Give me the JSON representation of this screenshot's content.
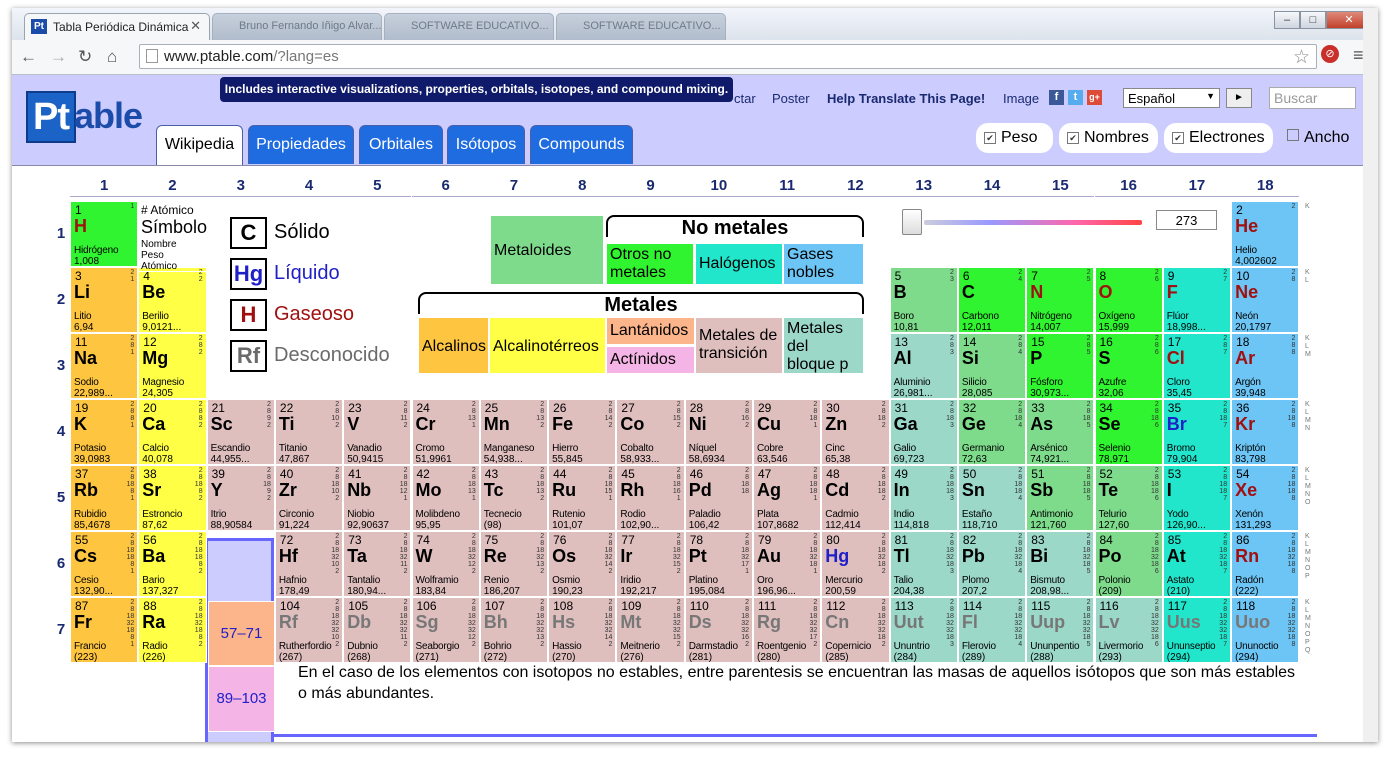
{
  "browser": {
    "tab_title": "Tabla Periódica Dinámica",
    "tab_favicon": "Pt",
    "ghost_tabs": [
      "Bruno Fernando Iñigo Alvar...",
      "SOFTWARE EDUCATIVO...",
      "SOFTWARE EDUCATIVO..."
    ],
    "url_host": "www.ptable.com",
    "url_path": "/?lang=es",
    "window_controls": [
      "–",
      "□",
      "✕"
    ]
  },
  "header": {
    "logo_pt": "Pt",
    "logo_rest": "able",
    "tooltip": "Includes interactive visualizations, properties, orbitals, isotopes, and compound mixing.",
    "links": {
      "contact": "ctar",
      "poster": "Poster",
      "translate": "Help Translate This Page!",
      "image": "Image"
    },
    "social": [
      "f",
      "t",
      "g+"
    ],
    "language": "Español",
    "go_button": "►",
    "search_placeholder": "Buscar",
    "tabs": [
      "Wikipedia",
      "Propiedades",
      "Orbitales",
      "Isótopos",
      "Compounds"
    ],
    "checkboxes": [
      {
        "label": "Peso",
        "checked": true
      },
      {
        "label": "Nombres",
        "checked": true
      },
      {
        "label": "Electrones",
        "checked": true
      },
      {
        "label": "Ancho",
        "checked": false
      }
    ]
  },
  "groups": [
    "1",
    "2",
    "3",
    "4",
    "5",
    "6",
    "7",
    "8",
    "9",
    "10",
    "11",
    "12",
    "13",
    "14",
    "15",
    "16",
    "17",
    "18"
  ],
  "periods": [
    "1",
    "2",
    "3",
    "4",
    "5",
    "6",
    "7"
  ],
  "key_cell": {
    "line1": "# Atómico",
    "line2": "Símbolo",
    "line3": "Nombre",
    "line4": "Peso",
    "line5": "Atómico"
  },
  "legend_states": [
    {
      "symbol": "C",
      "label": "Sólido",
      "color": "#000000"
    },
    {
      "symbol": "Hg",
      "label": "Líquido",
      "color": "#2020c8"
    },
    {
      "symbol": "H",
      "label": "Gaseoso",
      "color": "#a01010"
    },
    {
      "symbol": "Rf",
      "label": "Desconocido",
      "color": "#6a6a6a"
    }
  ],
  "legend_categories": {
    "nonmetals_title": "No metales",
    "metals_title": "Metales",
    "metaloides": "Metaloides",
    "otros": "Otros no metales",
    "halogenos": "Halógenos",
    "gases": "Gases nobles",
    "alcalinos": "Alcalinos",
    "alcalinoterreos": "Alcalinotérreos",
    "lantanidos": "Lantánidos",
    "actinidos": "Actínidos",
    "transicion": "Metales de transición",
    "bloquep": "Metales del bloque p"
  },
  "temperature": "273",
  "series_placeholders": [
    "57–71",
    "89–103"
  ],
  "footnote": "En el caso de los elementos con isotopos no estables, entre parentesis se encuentran las masas de aquellos isótopos que son más estables o más abundantes.",
  "shell_labels": [
    "K",
    "K L",
    "K L M",
    "K L M N",
    "K L M N O",
    "K L M N O P",
    "K L M N O P Q"
  ],
  "colors": {
    "alkali": "#fec640",
    "alkaline": "#ffff45",
    "transition": "#dfbebe",
    "ptrans": "#9cd8c8",
    "metalloid": "#7edb8c",
    "nonmetal": "#2ff42f",
    "halogen": "#22e6cc",
    "noble": "#6dc5f5",
    "lanth": "#fcb58a",
    "actin": "#f4b4e6",
    "accent": "#1f6ce0",
    "header_bg": "#ccccff"
  },
  "elements": [
    {
      "z": "1",
      "s": "H",
      "n": "Hidrógeno",
      "w": "1,008",
      "g": 1,
      "p": 1,
      "c": "nonmetal",
      "st": "gas",
      "e": "1"
    },
    {
      "z": "2",
      "s": "He",
      "n": "Helio",
      "w": "4,002602",
      "g": 18,
      "p": 1,
      "c": "noble",
      "st": "gas",
      "e": "2"
    },
    {
      "z": "3",
      "s": "Li",
      "n": "Litio",
      "w": "6,94",
      "g": 1,
      "p": 2,
      "c": "alkali",
      "st": "solid",
      "e": "2 1"
    },
    {
      "z": "4",
      "s": "Be",
      "n": "Berilio",
      "w": "9,0121...",
      "g": 2,
      "p": 2,
      "c": "alkaline",
      "st": "solid",
      "e": "2 2"
    },
    {
      "z": "5",
      "s": "B",
      "n": "Boro",
      "w": "10,81",
      "g": 13,
      "p": 2,
      "c": "metalloid",
      "st": "solid",
      "e": "2 3"
    },
    {
      "z": "6",
      "s": "C",
      "n": "Carbono",
      "w": "12,011",
      "g": 14,
      "p": 2,
      "c": "nonmetal",
      "st": "solid",
      "e": "2 4"
    },
    {
      "z": "7",
      "s": "N",
      "n": "Nitrógeno",
      "w": "14,007",
      "g": 15,
      "p": 2,
      "c": "nonmetal",
      "st": "gas",
      "e": "2 5"
    },
    {
      "z": "8",
      "s": "O",
      "n": "Oxígeno",
      "w": "15,999",
      "g": 16,
      "p": 2,
      "c": "nonmetal",
      "st": "gas",
      "e": "2 6"
    },
    {
      "z": "9",
      "s": "F",
      "n": "Flúor",
      "w": "18,998...",
      "g": 17,
      "p": 2,
      "c": "halogen",
      "st": "gas",
      "e": "2 7"
    },
    {
      "z": "10",
      "s": "Ne",
      "n": "Neón",
      "w": "20,1797",
      "g": 18,
      "p": 2,
      "c": "noble",
      "st": "gas",
      "e": "2 8"
    },
    {
      "z": "11",
      "s": "Na",
      "n": "Sodio",
      "w": "22,989...",
      "g": 1,
      "p": 3,
      "c": "alkali",
      "st": "solid",
      "e": "2 8 1"
    },
    {
      "z": "12",
      "s": "Mg",
      "n": "Magnesio",
      "w": "24,305",
      "g": 2,
      "p": 3,
      "c": "alkaline",
      "st": "solid",
      "e": "2 8 2"
    },
    {
      "z": "13",
      "s": "Al",
      "n": "Aluminio",
      "w": "26,981...",
      "g": 13,
      "p": 3,
      "c": "ptrans",
      "st": "solid",
      "e": "2 8 3"
    },
    {
      "z": "14",
      "s": "Si",
      "n": "Silicio",
      "w": "28,085",
      "g": 14,
      "p": 3,
      "c": "metalloid",
      "st": "solid",
      "e": "2 8 4"
    },
    {
      "z": "15",
      "s": "P",
      "n": "Fósforo",
      "w": "30,973...",
      "g": 15,
      "p": 3,
      "c": "nonmetal",
      "st": "solid",
      "e": "2 8 5"
    },
    {
      "z": "16",
      "s": "S",
      "n": "Azufre",
      "w": "32,06",
      "g": 16,
      "p": 3,
      "c": "nonmetal",
      "st": "solid",
      "e": "2 8 6"
    },
    {
      "z": "17",
      "s": "Cl",
      "n": "Cloro",
      "w": "35,45",
      "g": 17,
      "p": 3,
      "c": "halogen",
      "st": "gas",
      "e": "2 8 7"
    },
    {
      "z": "18",
      "s": "Ar",
      "n": "Argón",
      "w": "39,948",
      "g": 18,
      "p": 3,
      "c": "noble",
      "st": "gas",
      "e": "2 8 8"
    },
    {
      "z": "19",
      "s": "K",
      "n": "Potasio",
      "w": "39,0983",
      "g": 1,
      "p": 4,
      "c": "alkali",
      "st": "solid",
      "e": "2 8 8 1"
    },
    {
      "z": "20",
      "s": "Ca",
      "n": "Calcio",
      "w": "40,078",
      "g": 2,
      "p": 4,
      "c": "alkaline",
      "st": "solid",
      "e": "2 8 8 2"
    },
    {
      "z": "21",
      "s": "Sc",
      "n": "Escandio",
      "w": "44,955...",
      "g": 3,
      "p": 4,
      "c": "transition",
      "st": "solid",
      "e": "2 8 9 2"
    },
    {
      "z": "22",
      "s": "Ti",
      "n": "Titanio",
      "w": "47,867",
      "g": 4,
      "p": 4,
      "c": "transition",
      "st": "solid",
      "e": "2 8 10 2"
    },
    {
      "z": "23",
      "s": "V",
      "n": "Vanadio",
      "w": "50,9415",
      "g": 5,
      "p": 4,
      "c": "transition",
      "st": "solid",
      "e": "2 8 11 2"
    },
    {
      "z": "24",
      "s": "Cr",
      "n": "Cromo",
      "w": "51,9961",
      "g": 6,
      "p": 4,
      "c": "transition",
      "st": "solid",
      "e": "2 8 13 1"
    },
    {
      "z": "25",
      "s": "Mn",
      "n": "Manganeso",
      "w": "54,938...",
      "g": 7,
      "p": 4,
      "c": "transition",
      "st": "solid",
      "e": "2 8 13 2"
    },
    {
      "z": "26",
      "s": "Fe",
      "n": "Hierro",
      "w": "55,845",
      "g": 8,
      "p": 4,
      "c": "transition",
      "st": "solid",
      "e": "2 8 14 2"
    },
    {
      "z": "27",
      "s": "Co",
      "n": "Cobalto",
      "w": "58,933...",
      "g": 9,
      "p": 4,
      "c": "transition",
      "st": "solid",
      "e": "2 8 15 2"
    },
    {
      "z": "28",
      "s": "Ni",
      "n": "Níquel",
      "w": "58,6934",
      "g": 10,
      "p": 4,
      "c": "transition",
      "st": "solid",
      "e": "2 8 16 2"
    },
    {
      "z": "29",
      "s": "Cu",
      "n": "Cobre",
      "w": "63,546",
      "g": 11,
      "p": 4,
      "c": "transition",
      "st": "solid",
      "e": "2 8 18 1"
    },
    {
      "z": "30",
      "s": "Zn",
      "n": "Cinc",
      "w": "65,38",
      "g": 12,
      "p": 4,
      "c": "transition",
      "st": "solid",
      "e": "2 8 18 2"
    },
    {
      "z": "31",
      "s": "Ga",
      "n": "Galio",
      "w": "69,723",
      "g": 13,
      "p": 4,
      "c": "ptrans",
      "st": "solid",
      "e": "2 8 18 3"
    },
    {
      "z": "32",
      "s": "Ge",
      "n": "Germanio",
      "w": "72,63",
      "g": 14,
      "p": 4,
      "c": "metalloid",
      "st": "solid",
      "e": "2 8 18 4"
    },
    {
      "z": "33",
      "s": "As",
      "n": "Arsénico",
      "w": "74,921...",
      "g": 15,
      "p": 4,
      "c": "metalloid",
      "st": "solid",
      "e": "2 8 18 5"
    },
    {
      "z": "34",
      "s": "Se",
      "n": "Selenio",
      "w": "78,971",
      "g": 16,
      "p": 4,
      "c": "nonmetal",
      "st": "solid",
      "e": "2 8 18 6"
    },
    {
      "z": "35",
      "s": "Br",
      "n": "Bromo",
      "w": "79,904",
      "g": 17,
      "p": 4,
      "c": "halogen",
      "st": "liquid",
      "e": "2 8 18 7"
    },
    {
      "z": "36",
      "s": "Kr",
      "n": "Kriptón",
      "w": "83,798",
      "g": 18,
      "p": 4,
      "c": "noble",
      "st": "gas",
      "e": "2 8 18 8"
    },
    {
      "z": "37",
      "s": "Rb",
      "n": "Rubidio",
      "w": "85,4678",
      "g": 1,
      "p": 5,
      "c": "alkali",
      "st": "solid",
      "e": "2 8 18 8 1"
    },
    {
      "z": "38",
      "s": "Sr",
      "n": "Estroncio",
      "w": "87,62",
      "g": 2,
      "p": 5,
      "c": "alkaline",
      "st": "solid",
      "e": "2 8 18 8 2"
    },
    {
      "z": "39",
      "s": "Y",
      "n": "Itrio",
      "w": "88,90584",
      "g": 3,
      "p": 5,
      "c": "transition",
      "st": "solid",
      "e": "2 8 18 9 2"
    },
    {
      "z": "40",
      "s": "Zr",
      "n": "Circonio",
      "w": "91,224",
      "g": 4,
      "p": 5,
      "c": "transition",
      "st": "solid",
      "e": "2 8 18 10 2"
    },
    {
      "z": "41",
      "s": "Nb",
      "n": "Niobio",
      "w": "92,90637",
      "g": 5,
      "p": 5,
      "c": "transition",
      "st": "solid",
      "e": "2 8 18 12 1"
    },
    {
      "z": "42",
      "s": "Mo",
      "n": "Molibdeno",
      "w": "95,95",
      "g": 6,
      "p": 5,
      "c": "transition",
      "st": "solid",
      "e": "2 8 18 13 1"
    },
    {
      "z": "43",
      "s": "Tc",
      "n": "Tecnecio",
      "w": "(98)",
      "g": 7,
      "p": 5,
      "c": "transition",
      "st": "solid",
      "e": "2 8 18 13 2"
    },
    {
      "z": "44",
      "s": "Ru",
      "n": "Rutenio",
      "w": "101,07",
      "g": 8,
      "p": 5,
      "c": "transition",
      "st": "solid",
      "e": "2 8 18 15 1"
    },
    {
      "z": "45",
      "s": "Rh",
      "n": "Rodio",
      "w": "102,90...",
      "g": 9,
      "p": 5,
      "c": "transition",
      "st": "solid",
      "e": "2 8 18 16 1"
    },
    {
      "z": "46",
      "s": "Pd",
      "n": "Paladio",
      "w": "106,42",
      "g": 10,
      "p": 5,
      "c": "transition",
      "st": "solid",
      "e": "2 8 18 18"
    },
    {
      "z": "47",
      "s": "Ag",
      "n": "Plata",
      "w": "107,8682",
      "g": 11,
      "p": 5,
      "c": "transition",
      "st": "solid",
      "e": "2 8 18 18 1"
    },
    {
      "z": "48",
      "s": "Cd",
      "n": "Cadmio",
      "w": "112,414",
      "g": 12,
      "p": 5,
      "c": "transition",
      "st": "solid",
      "e": "2 8 18 18 2"
    },
    {
      "z": "49",
      "s": "In",
      "n": "Indio",
      "w": "114,818",
      "g": 13,
      "p": 5,
      "c": "ptrans",
      "st": "solid",
      "e": "2 8 18 18 3"
    },
    {
      "z": "50",
      "s": "Sn",
      "n": "Estaño",
      "w": "118,710",
      "g": 14,
      "p": 5,
      "c": "ptrans",
      "st": "solid",
      "e": "2 8 18 18 4"
    },
    {
      "z": "51",
      "s": "Sb",
      "n": "Antimonio",
      "w": "121,760",
      "g": 15,
      "p": 5,
      "c": "metalloid",
      "st": "solid",
      "e": "2 8 18 18 5"
    },
    {
      "z": "52",
      "s": "Te",
      "n": "Telurio",
      "w": "127,60",
      "g": 16,
      "p": 5,
      "c": "metalloid",
      "st": "solid",
      "e": "2 8 18 18 6"
    },
    {
      "z": "53",
      "s": "I",
      "n": "Yodo",
      "w": "126,90...",
      "g": 17,
      "p": 5,
      "c": "halogen",
      "st": "solid",
      "e": "2 8 18 18 7"
    },
    {
      "z": "54",
      "s": "Xe",
      "n": "Xenón",
      "w": "131,293",
      "g": 18,
      "p": 5,
      "c": "noble",
      "st": "gas",
      "e": "2 8 18 18 8"
    },
    {
      "z": "55",
      "s": "Cs",
      "n": "Cesio",
      "w": "132,90...",
      "g": 1,
      "p": 6,
      "c": "alkali",
      "st": "solid",
      "e": "2 8 18 18 8 1"
    },
    {
      "z": "56",
      "s": "Ba",
      "n": "Bario",
      "w": "137,327",
      "g": 2,
      "p": 6,
      "c": "alkaline",
      "st": "solid",
      "e": "2 8 18 18 8 2"
    },
    {
      "z": "72",
      "s": "Hf",
      "n": "Hafnio",
      "w": "178,49",
      "g": 4,
      "p": 6,
      "c": "transition",
      "st": "solid",
      "e": "2 8 18 32 10 2"
    },
    {
      "z": "73",
      "s": "Ta",
      "n": "Tantalio",
      "w": "180,94...",
      "g": 5,
      "p": 6,
      "c": "transition",
      "st": "solid",
      "e": "2 8 18 32 11 2"
    },
    {
      "z": "74",
      "s": "W",
      "n": "Wolframio",
      "w": "183,84",
      "g": 6,
      "p": 6,
      "c": "transition",
      "st": "solid",
      "e": "2 8 18 32 12 2"
    },
    {
      "z": "75",
      "s": "Re",
      "n": "Renio",
      "w": "186,207",
      "g": 7,
      "p": 6,
      "c": "transition",
      "st": "solid",
      "e": "2 8 18 32 13 2"
    },
    {
      "z": "76",
      "s": "Os",
      "n": "Osmio",
      "w": "190,23",
      "g": 8,
      "p": 6,
      "c": "transition",
      "st": "solid",
      "e": "2 8 18 32 14 2"
    },
    {
      "z": "77",
      "s": "Ir",
      "n": "Iridio",
      "w": "192,217",
      "g": 9,
      "p": 6,
      "c": "transition",
      "st": "solid",
      "e": "2 8 18 32 15 2"
    },
    {
      "z": "78",
      "s": "Pt",
      "n": "Platino",
      "w": "195,084",
      "g": 10,
      "p": 6,
      "c": "transition",
      "st": "solid",
      "e": "2 8 18 32 17 1"
    },
    {
      "z": "79",
      "s": "Au",
      "n": "Oro",
      "w": "196,96...",
      "g": 11,
      "p": 6,
      "c": "transition",
      "st": "solid",
      "e": "2 8 18 32 18 1"
    },
    {
      "z": "80",
      "s": "Hg",
      "n": "Mercurio",
      "w": "200,59",
      "g": 12,
      "p": 6,
      "c": "transition",
      "st": "liquid",
      "e": "2 8 18 32 18 2"
    },
    {
      "z": "81",
      "s": "Tl",
      "n": "Talio",
      "w": "204,38",
      "g": 13,
      "p": 6,
      "c": "ptrans",
      "st": "solid",
      "e": "2 8 18 32 18 3"
    },
    {
      "z": "82",
      "s": "Pb",
      "n": "Plomo",
      "w": "207,2",
      "g": 14,
      "p": 6,
      "c": "ptrans",
      "st": "solid",
      "e": "2 8 18 32 18 4"
    },
    {
      "z": "83",
      "s": "Bi",
      "n": "Bismuto",
      "w": "208,98...",
      "g": 15,
      "p": 6,
      "c": "ptrans",
      "st": "solid",
      "e": "2 8 18 32 18 5"
    },
    {
      "z": "84",
      "s": "Po",
      "n": "Polonio",
      "w": "(209)",
      "g": 16,
      "p": 6,
      "c": "metalloid",
      "st": "solid",
      "e": "2 8 18 32 18 6"
    },
    {
      "z": "85",
      "s": "At",
      "n": "Astato",
      "w": "(210)",
      "g": 17,
      "p": 6,
      "c": "halogen",
      "st": "solid",
      "e": "2 8 18 32 18 7"
    },
    {
      "z": "86",
      "s": "Rn",
      "n": "Radón",
      "w": "(222)",
      "g": 18,
      "p": 6,
      "c": "noble",
      "st": "gas",
      "e": "2 8 18 32 18 8"
    },
    {
      "z": "87",
      "s": "Fr",
      "n": "Francio",
      "w": "(223)",
      "g": 1,
      "p": 7,
      "c": "alkali",
      "st": "solid",
      "e": "2 8 18 32 18 8 1"
    },
    {
      "z": "88",
      "s": "Ra",
      "n": "Radio",
      "w": "(226)",
      "g": 2,
      "p": 7,
      "c": "alkaline",
      "st": "solid",
      "e": "2 8 18 32 18 8 2"
    },
    {
      "z": "104",
      "s": "Rf",
      "n": "Rutherfordio",
      "w": "(267)",
      "g": 4,
      "p": 7,
      "c": "transition",
      "st": "unknown",
      "e": "2 8 18 32 32 10 2"
    },
    {
      "z": "105",
      "s": "Db",
      "n": "Dubnio",
      "w": "(268)",
      "g": 5,
      "p": 7,
      "c": "transition",
      "st": "unknown",
      "e": "2 8 18 32 32 11 2"
    },
    {
      "z": "106",
      "s": "Sg",
      "n": "Seaborgio",
      "w": "(271)",
      "g": 6,
      "p": 7,
      "c": "transition",
      "st": "unknown",
      "e": "2 8 18 32 32 12 2"
    },
    {
      "z": "107",
      "s": "Bh",
      "n": "Bohrio",
      "w": "(272)",
      "g": 7,
      "p": 7,
      "c": "transition",
      "st": "unknown",
      "e": "2 8 18 32 32 13 2"
    },
    {
      "z": "108",
      "s": "Hs",
      "n": "Hassio",
      "w": "(270)",
      "g": 8,
      "p": 7,
      "c": "transition",
      "st": "unknown",
      "e": "2 8 18 32 32 14 2"
    },
    {
      "z": "109",
      "s": "Mt",
      "n": "Meitnerio",
      "w": "(276)",
      "g": 9,
      "p": 7,
      "c": "transition",
      "st": "unknown",
      "e": "2 8 18 32 32 15 2"
    },
    {
      "z": "110",
      "s": "Ds",
      "n": "Darmstadio",
      "w": "(281)",
      "g": 10,
      "p": 7,
      "c": "transition",
      "st": "unknown",
      "e": "2 8 18 32 32 16 2"
    },
    {
      "z": "111",
      "s": "Rg",
      "n": "Roentgenio",
      "w": "(280)",
      "g": 11,
      "p": 7,
      "c": "transition",
      "st": "unknown",
      "e": "2 8 18 32 32 17 2"
    },
    {
      "z": "112",
      "s": "Cn",
      "n": "Copernicio",
      "w": "(285)",
      "g": 12,
      "p": 7,
      "c": "transition",
      "st": "unknown",
      "e": "2 8 18 32 32 18 2"
    },
    {
      "z": "113",
      "s": "Uut",
      "n": "Ununtrio",
      "w": "(284)",
      "g": 13,
      "p": 7,
      "c": "ptrans",
      "st": "unknown",
      "e": "2 8 18 32 32 18 3"
    },
    {
      "z": "114",
      "s": "Fl",
      "n": "Flerovio",
      "w": "(289)",
      "g": 14,
      "p": 7,
      "c": "ptrans",
      "st": "unknown",
      "e": "2 8 18 32 32 18 4"
    },
    {
      "z": "115",
      "s": "Uup",
      "n": "Ununpentio",
      "w": "(288)",
      "g": 15,
      "p": 7,
      "c": "ptrans",
      "st": "unknown",
      "e": "2 8 18 32 32 18 5"
    },
    {
      "z": "116",
      "s": "Lv",
      "n": "Livermorio",
      "w": "(293)",
      "g": 16,
      "p": 7,
      "c": "ptrans",
      "st": "unknown",
      "e": "2 8 18 32 32 18 6"
    },
    {
      "z": "117",
      "s": "Uus",
      "n": "Ununseptio",
      "w": "(294)",
      "g": 17,
      "p": 7,
      "c": "halogen",
      "st": "unknown",
      "e": "2 8 18 32 32 18 7"
    },
    {
      "z": "118",
      "s": "Uuo",
      "n": "Ununoctio",
      "w": "(294)",
      "g": 18,
      "p": 7,
      "c": "noble",
      "st": "unknown",
      "e": "2 8 18 32 32 18 8"
    }
  ]
}
